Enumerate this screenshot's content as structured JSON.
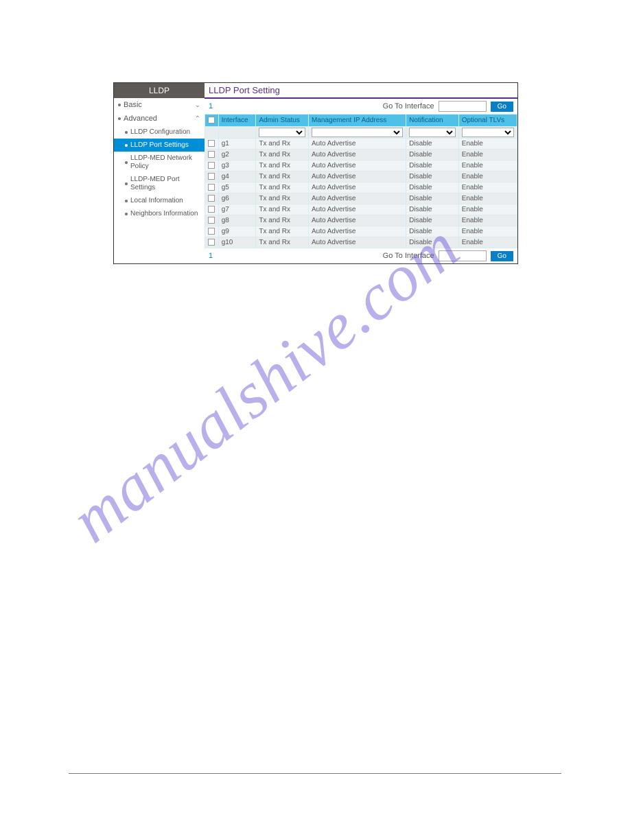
{
  "watermark": "manualshive.com",
  "sidebar": {
    "header": "LLDP",
    "items": [
      {
        "label": "Basic",
        "level": "top",
        "chev": "v"
      },
      {
        "label": "Advanced",
        "level": "top",
        "chev": "^"
      },
      {
        "label": "LLDP Configuration",
        "level": "sub"
      },
      {
        "label": "LLDP Port Settings",
        "level": "sub",
        "active": true
      },
      {
        "label": "LLDP-MED Network Policy",
        "level": "sub2"
      },
      {
        "label": "LLDP-MED Port Settings",
        "level": "sub2"
      },
      {
        "label": "Local Information",
        "level": "sub"
      },
      {
        "label": "Neighbors Information",
        "level": "sub"
      }
    ]
  },
  "panel": {
    "title": "LLDP Port Setting",
    "page_indicator": "1",
    "goto_label": "Go To Interface",
    "go_button": "Go",
    "headers": [
      "",
      "Interface",
      "Admin Status",
      "Management IP Address",
      "Notification",
      "Optional TLVs"
    ],
    "rows": [
      {
        "iface": "g1",
        "admin": "Tx and Rx",
        "mgmt": "Auto Advertise",
        "notif": "Disable",
        "tlv": "Enable"
      },
      {
        "iface": "g2",
        "admin": "Tx and Rx",
        "mgmt": "Auto Advertise",
        "notif": "Disable",
        "tlv": "Enable"
      },
      {
        "iface": "g3",
        "admin": "Tx and Rx",
        "mgmt": "Auto Advertise",
        "notif": "Disable",
        "tlv": "Enable"
      },
      {
        "iface": "g4",
        "admin": "Tx and Rx",
        "mgmt": "Auto Advertise",
        "notif": "Disable",
        "tlv": "Enable"
      },
      {
        "iface": "g5",
        "admin": "Tx and Rx",
        "mgmt": "Auto Advertise",
        "notif": "Disable",
        "tlv": "Enable"
      },
      {
        "iface": "g6",
        "admin": "Tx and Rx",
        "mgmt": "Auto Advertise",
        "notif": "Disable",
        "tlv": "Enable"
      },
      {
        "iface": "g7",
        "admin": "Tx and Rx",
        "mgmt": "Auto Advertise",
        "notif": "Disable",
        "tlv": "Enable"
      },
      {
        "iface": "g8",
        "admin": "Tx and Rx",
        "mgmt": "Auto Advertise",
        "notif": "Disable",
        "tlv": "Enable"
      },
      {
        "iface": "g9",
        "admin": "Tx and Rx",
        "mgmt": "Auto Advertise",
        "notif": "Disable",
        "tlv": "Enable"
      },
      {
        "iface": "g10",
        "admin": "Tx and Rx",
        "mgmt": "Auto Advertise",
        "notif": "Disable",
        "tlv": "Enable"
      }
    ]
  }
}
